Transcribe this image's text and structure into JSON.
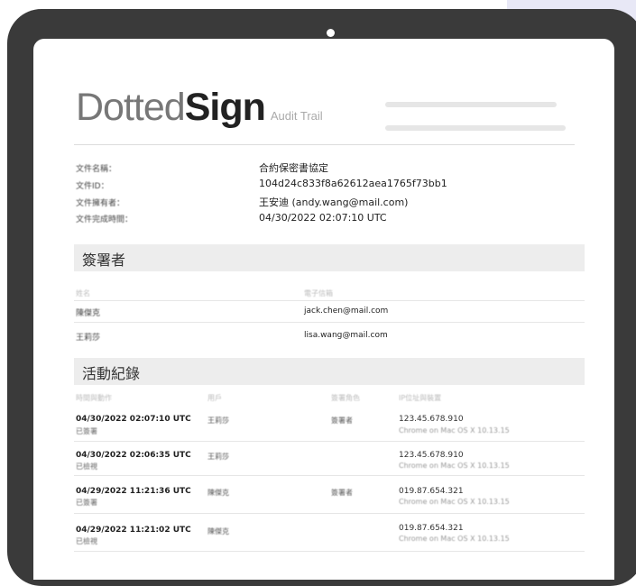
{
  "header": {
    "logo_dotted": "Dotted",
    "logo_sign": "Sign",
    "subtitle": "Audit Trail"
  },
  "document_info": {
    "labels": [
      "文件名稱：",
      "文件ID：",
      "文件擁有者：",
      "文件完成時間："
    ],
    "values": [
      "合約保密書協定",
      "104d24c833f8a62612aea1765f73bb1",
      "王安迪 (andy.wang@mail.com)",
      "04/30/2022  02:07:10  UTC"
    ]
  },
  "signers": {
    "title": "簽署者",
    "columns": [
      "姓名",
      "電子信箱"
    ],
    "rows": [
      {
        "name": "陳傑克",
        "email": "jack.chen@mail.com"
      },
      {
        "name": "王莉莎",
        "email": "lisa.wang@mail.com"
      }
    ]
  },
  "activity": {
    "title": "活動紀錄",
    "columns": [
      "時間與動作",
      "用戶",
      "簽署角色",
      "IP位址與裝置"
    ],
    "rows": [
      {
        "time": "04/30/2022  02:07:10  UTC",
        "action": "已簽署",
        "user": "王莉莎",
        "role": "簽署者",
        "ip": "123.45.678.910",
        "agent": "Chrome on Mac OS X 10.13.15"
      },
      {
        "time": "04/30/2022  02:06:35  UTC",
        "action": "已檢視",
        "user": "王莉莎",
        "role": "",
        "ip": "123.45.678.910",
        "agent": "Chrome on Mac OS X 10.13.15"
      },
      {
        "time": "04/29/2022  11:21:36  UTC",
        "action": "已簽署",
        "user": "陳傑克",
        "role": "簽署者",
        "ip": "019.87.654.321",
        "agent": "Chrome on Mac OS X 10.13.15"
      },
      {
        "time": "04/29/2022  11:21:02  UTC",
        "action": "已檢視",
        "user": "陳傑克",
        "role": "",
        "ip": "019.87.654.321",
        "agent": "Chrome on Mac OS X 10.13.15"
      }
    ]
  },
  "colors": {
    "device_frame": "#3a3a3a",
    "section_bar": "#ededed",
    "background_accent": "#e8e8f6"
  }
}
